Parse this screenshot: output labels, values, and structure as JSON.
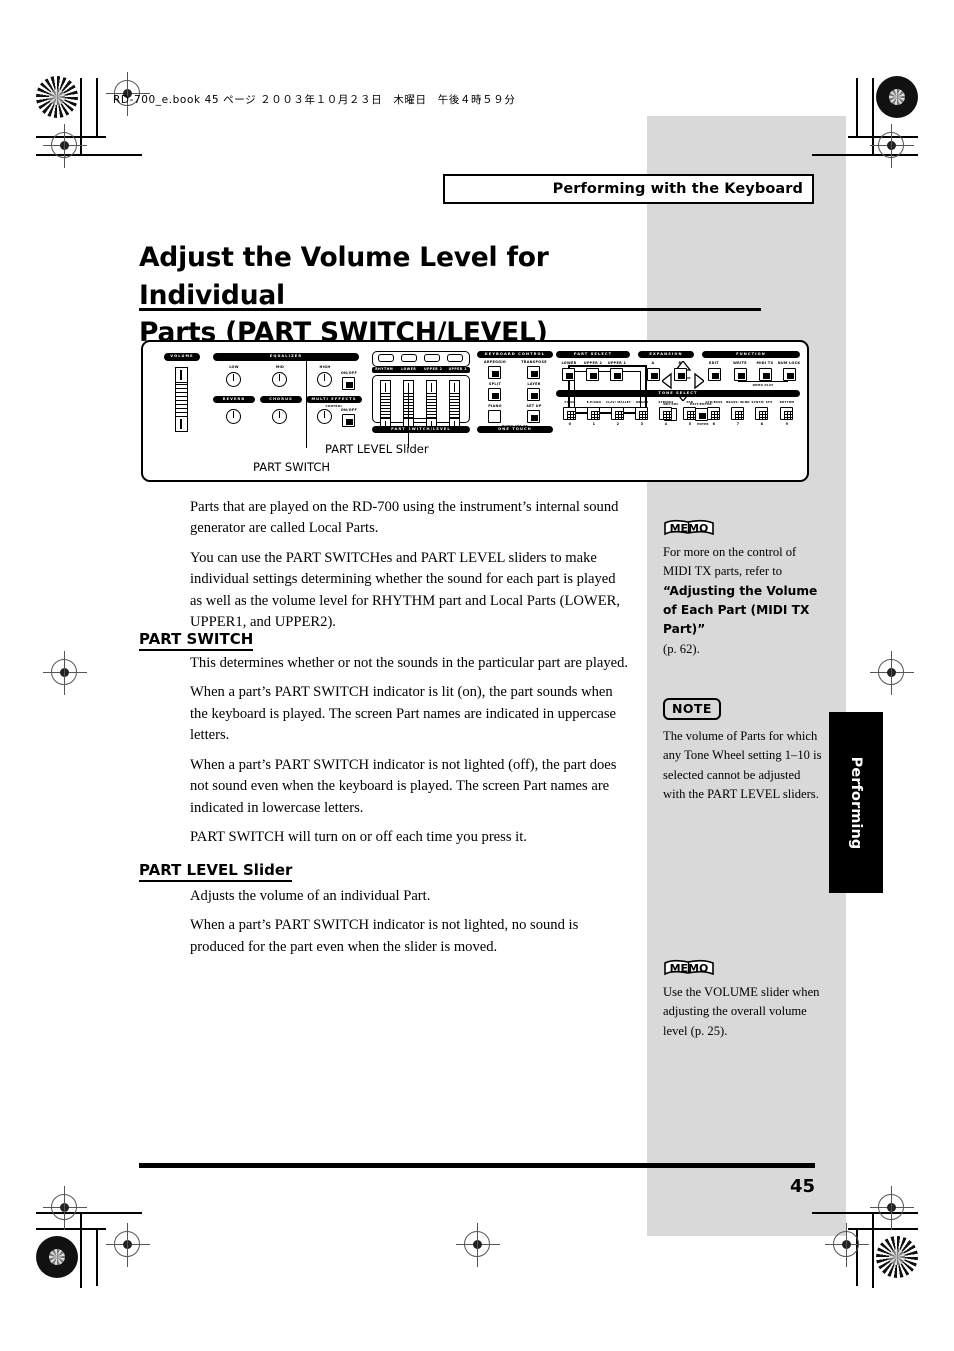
{
  "document": {
    "book_meta": "RD-700_e.book  45 ページ  ２００３年１０月２３日　木曜日　午後４時５９分",
    "running_head": "Performing with the Keyboard",
    "title_line1": "Adjust the Volume Level for Individual",
    "title_line2": "Parts (PART SWITCH/LEVEL)",
    "page_number": "45",
    "side_tab": "Performing"
  },
  "figure": {
    "callout_part_level": "PART LEVEL Slider",
    "callout_part_switch": "PART SWITCH",
    "panel": {
      "volume_label": "VOLUME",
      "equalizer_label": "EQUALIZER",
      "eq_knobs": [
        "LOW",
        "MID",
        "HIGH"
      ],
      "onoff_label_1": "ON/OFF",
      "onoff_label_2": "ON/OFF",
      "reverb_label": "REVERB",
      "chorus_label": "CHORUS",
      "multi_effects_label": "MULTI EFFECTS",
      "control_label": "CONTROL",
      "part_switch_buttons": [
        "RHYTHM",
        "LOWER",
        "UPPER 2",
        "UPPER 1"
      ],
      "part_switch_level_label": "PART SWITCH/LEVEL",
      "keyboard_control_label": "KEYBOARD CONTROL",
      "keyboard_buttons": [
        "ARPEGGIO",
        "TRANSPOSE",
        "SPLIT",
        "LAYER",
        "PIANO",
        "SET UP"
      ],
      "piano_setup_label": "PIANO SET UP",
      "one_touch_label": "ONE TOUCH",
      "cursor_label": "CURSOR",
      "dec_inc_label": "DEC/INC",
      "exit_enter_label": "EXIT/ENTER",
      "enter_label": "ENTER",
      "part_select_label": "PART SELECT",
      "part_select_buttons": [
        "LOWER",
        "UPPER 2",
        "UPPER 1"
      ],
      "expansion_label": "EXPANSION",
      "expansion_buttons": [
        "A",
        "B"
      ],
      "function_label": "FUNCTION",
      "function_buttons": [
        "EDIT",
        "WRITE",
        "MIDI TX",
        "NUM LOCK"
      ],
      "demo_play_label": "DEMO PLAY",
      "tone_select_label": "TONE SELECT",
      "tone_select_buttons": [
        "PIANO",
        "E.PIANO",
        "CLAV/ MALLET",
        "ORGAN",
        "STRINGS",
        "PAD",
        "GTR/BASS",
        "BRASS/ WIND",
        "SYNTH/ SFX",
        "RHYTHM"
      ],
      "tone_select_numbers": [
        "0",
        "1",
        "2",
        "3",
        "4",
        "5",
        "6",
        "7",
        "8",
        "9"
      ]
    }
  },
  "body": {
    "intro_paragraphs": [
      "Parts that are played on the RD-700 using the instrument’s internal sound generator are called Local Parts.",
      "You can use the PART SWITCHes and PART LEVEL sliders to make individual settings determining whether the sound for each part is played as well as the volume level for RHYTHM part and Local Parts (LOWER, UPPER1, and UPPER2)."
    ],
    "section1": {
      "heading": "PART SWITCH",
      "paragraphs": [
        "This determines whether or not the sounds in the particular part are played.",
        "When a part’s PART SWITCH indicator is lit (on), the part sounds when the keyboard is played. The screen Part names are indicated in uppercase letters.",
        "When a part’s PART SWITCH indicator is not lighted (off), the part does not sound even when the keyboard is played. The screen Part names are indicated in lowercase letters.",
        "PART SWITCH will turn on or off each time you press it."
      ]
    },
    "section2": {
      "heading": "PART LEVEL Slider",
      "paragraphs": [
        "Adjusts the volume of an individual Part.",
        "When a part’s PART SWITCH indicator is not lighted, no sound is produced for the part even when the slider is moved."
      ]
    }
  },
  "sidebar": {
    "memo1": {
      "badge": "MEMO",
      "text_plain_1": "For more on the control of MIDI TX parts, refer to",
      "text_bold": "“Adjusting the Volume of Each Part (MIDI TX Part)”",
      "text_plain_2": "(p. 62)."
    },
    "note1": {
      "badge": "NOTE",
      "text": "The volume of Parts for which any Tone Wheel setting 1–10 is selected cannot be adjusted with the PART LEVEL sliders."
    },
    "memo2": {
      "badge": "MEMO",
      "text": "Use the VOLUME slider when adjusting the overall volume level (p. 25)."
    }
  },
  "colors": {
    "gray_band": "#d9d9d9",
    "ink": "#000000",
    "paper": "#ffffff"
  }
}
